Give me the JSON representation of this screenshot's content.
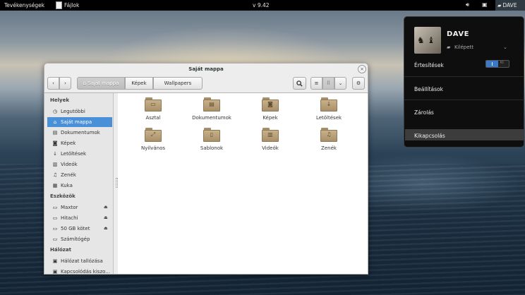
{
  "topbar": {
    "activities": "Tevékenységek",
    "app_name": "Fájlok",
    "clock": "v 9.42",
    "user": "DAVE",
    "icons": {
      "volume": "volume-icon",
      "network": "network-icon",
      "user": "chat-bubble-icon"
    }
  },
  "user_menu": {
    "name": "DAVE",
    "status": "Kilépett",
    "notifications_label": "Értesítések",
    "toggle_on": "I",
    "toggle_off": "KI",
    "items": [
      "Beállítások",
      "Zárolás",
      "Kikapcsolás"
    ],
    "highlighted_item": "Kikapcsolás"
  },
  "window": {
    "title": "Saját mappa",
    "close": "×",
    "nav": {
      "back": "‹",
      "forward": "›"
    },
    "path": [
      {
        "label": "Saját mappa",
        "active": true
      },
      {
        "label": "Képek",
        "active": false
      },
      {
        "label": "Wallpapers",
        "active": false
      }
    ],
    "toolbar_icons": {
      "search": "search-icon",
      "list_view": "list-view-icon",
      "grid_view": "grid-view-icon",
      "view_menu": "chevron-down-icon",
      "settings": "gear-icon"
    }
  },
  "sidebar": {
    "sections": [
      {
        "header": "Helyek",
        "items": [
          {
            "label": "Legutóbbi",
            "icon": "clock-icon"
          },
          {
            "label": "Saját mappa",
            "icon": "home-icon",
            "selected": true
          },
          {
            "label": "Dokumentumok",
            "icon": "document-icon"
          },
          {
            "label": "Képek",
            "icon": "camera-icon"
          },
          {
            "label": "Letöltések",
            "icon": "download-icon"
          },
          {
            "label": "Videók",
            "icon": "film-icon"
          },
          {
            "label": "Zenék",
            "icon": "music-icon"
          },
          {
            "label": "Kuka",
            "icon": "trash-icon"
          }
        ]
      },
      {
        "header": "Eszközök",
        "items": [
          {
            "label": "Maxtor",
            "icon": "drive-icon",
            "eject": true
          },
          {
            "label": "Hitachi",
            "icon": "drive-icon",
            "eject": true
          },
          {
            "label": "50 GB kötet",
            "icon": "drive-icon",
            "eject": true
          },
          {
            "label": "Számítógép",
            "icon": "drive-icon"
          }
        ]
      },
      {
        "header": "Hálózat",
        "items": [
          {
            "label": "Hálózat tallózása",
            "icon": "network-icon"
          },
          {
            "label": "Kapcsolódás kiszo...",
            "icon": "server-icon"
          }
        ]
      }
    ]
  },
  "files": [
    {
      "label": "Asztal",
      "emblem": "desktop-icon"
    },
    {
      "label": "Dokumentumok",
      "emblem": "document-icon"
    },
    {
      "label": "Képek",
      "emblem": "camera-icon"
    },
    {
      "label": "Letöltések",
      "emblem": "download-icon"
    },
    {
      "label": "Nyilvános",
      "emblem": "share-icon"
    },
    {
      "label": "Sablonok",
      "emblem": "template-icon"
    },
    {
      "label": "Videók",
      "emblem": "film-icon"
    },
    {
      "label": "Zenék",
      "emblem": "music-icon"
    }
  ],
  "colors": {
    "selection": "#4a90d9",
    "folder": "#b59d76",
    "topbar": "#000000",
    "toggle_on": "#3a79c9"
  }
}
